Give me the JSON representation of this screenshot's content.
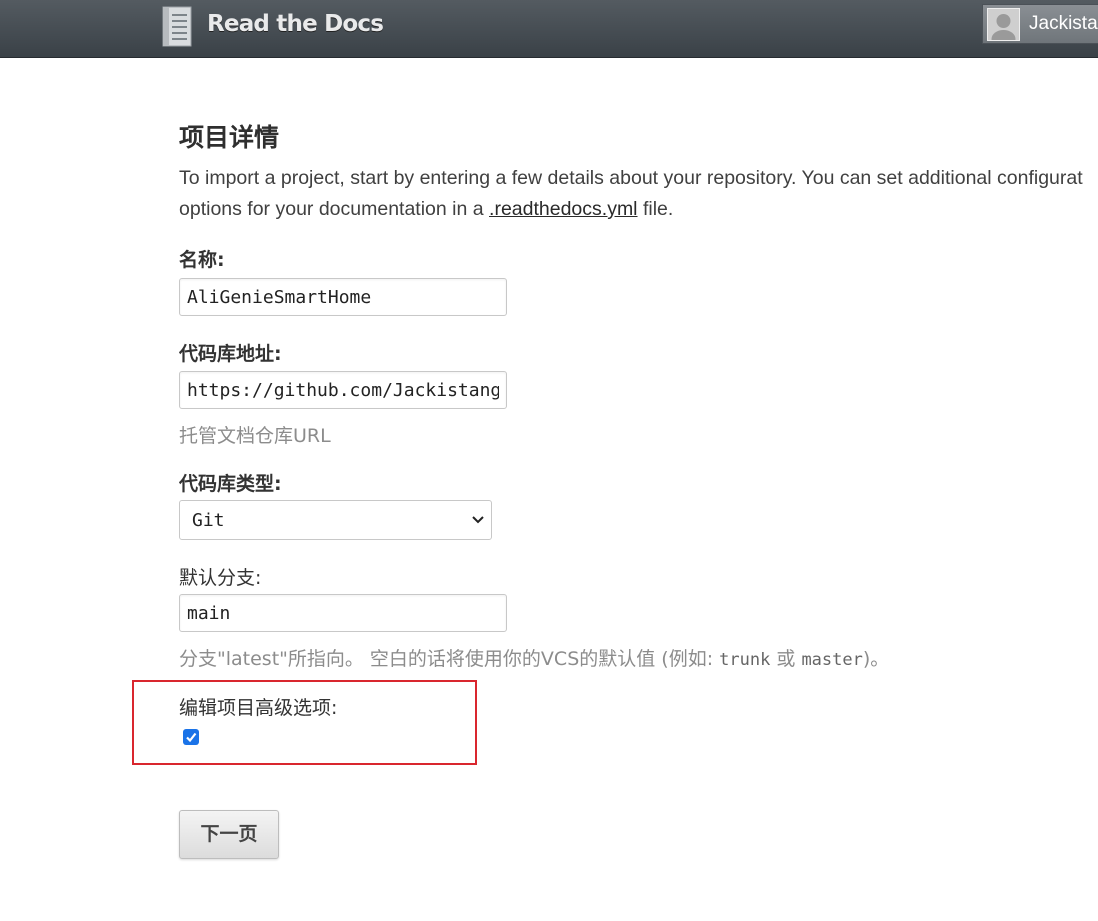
{
  "header": {
    "logo_text": "Read the Docs",
    "logo_icon": "book-icon",
    "username": "Jackista"
  },
  "main": {
    "title": "项目详情",
    "intro_line1": "To import a project, start by entering a few details about your repository. You can set additional configurat",
    "intro_line2_before": "options for your documentation in a ",
    "intro_link": ".readthedocs.yml",
    "intro_line2_after": " file.",
    "fields": {
      "name": {
        "label": "名称:",
        "value": "AliGenieSmartHome"
      },
      "repo": {
        "label": "代码库地址:",
        "value": "https://github.com/Jackistang",
        "help": "托管文档仓库URL"
      },
      "repo_type": {
        "label": "代码库类型:",
        "value": "Git"
      },
      "default_branch": {
        "label": "默认分支:",
        "value": "main",
        "help_before": "分支\"latest\"所指向。 空白的话将使用你的VCS的默认值 (例如: ",
        "help_code1": "trunk",
        "help_mid": " 或 ",
        "help_code2": "master",
        "help_after": ")。"
      },
      "advanced": {
        "label": "编辑项目高级选项:",
        "checked": true
      }
    },
    "next_button": "下一页"
  },
  "colors": {
    "header_bg": "#474e54",
    "highlight_border": "#d9262e",
    "checkbox": "#1a73e8"
  }
}
